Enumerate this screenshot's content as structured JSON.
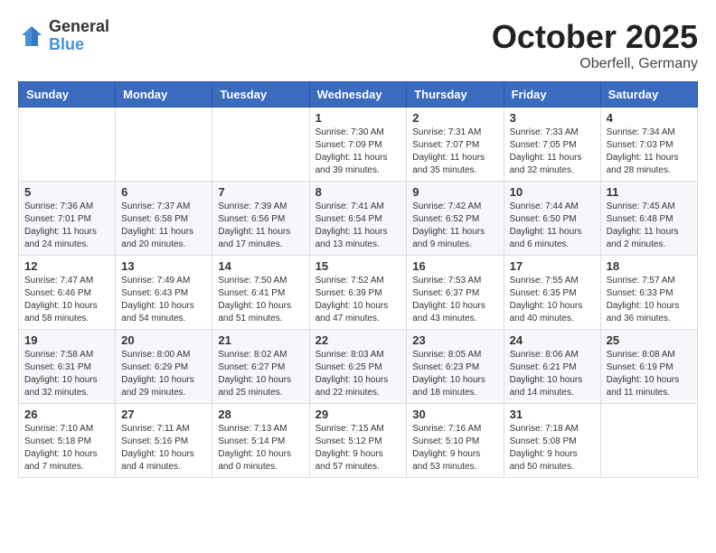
{
  "header": {
    "logo_general": "General",
    "logo_blue": "Blue",
    "month": "October 2025",
    "location": "Oberfell, Germany"
  },
  "weekdays": [
    "Sunday",
    "Monday",
    "Tuesday",
    "Wednesday",
    "Thursday",
    "Friday",
    "Saturday"
  ],
  "weeks": [
    [
      {
        "day": "",
        "info": ""
      },
      {
        "day": "",
        "info": ""
      },
      {
        "day": "",
        "info": ""
      },
      {
        "day": "1",
        "info": "Sunrise: 7:30 AM\nSunset: 7:09 PM\nDaylight: 11 hours\nand 39 minutes."
      },
      {
        "day": "2",
        "info": "Sunrise: 7:31 AM\nSunset: 7:07 PM\nDaylight: 11 hours\nand 35 minutes."
      },
      {
        "day": "3",
        "info": "Sunrise: 7:33 AM\nSunset: 7:05 PM\nDaylight: 11 hours\nand 32 minutes."
      },
      {
        "day": "4",
        "info": "Sunrise: 7:34 AM\nSunset: 7:03 PM\nDaylight: 11 hours\nand 28 minutes."
      }
    ],
    [
      {
        "day": "5",
        "info": "Sunrise: 7:36 AM\nSunset: 7:01 PM\nDaylight: 11 hours\nand 24 minutes."
      },
      {
        "day": "6",
        "info": "Sunrise: 7:37 AM\nSunset: 6:58 PM\nDaylight: 11 hours\nand 20 minutes."
      },
      {
        "day": "7",
        "info": "Sunrise: 7:39 AM\nSunset: 6:56 PM\nDaylight: 11 hours\nand 17 minutes."
      },
      {
        "day": "8",
        "info": "Sunrise: 7:41 AM\nSunset: 6:54 PM\nDaylight: 11 hours\nand 13 minutes."
      },
      {
        "day": "9",
        "info": "Sunrise: 7:42 AM\nSunset: 6:52 PM\nDaylight: 11 hours\nand 9 minutes."
      },
      {
        "day": "10",
        "info": "Sunrise: 7:44 AM\nSunset: 6:50 PM\nDaylight: 11 hours\nand 6 minutes."
      },
      {
        "day": "11",
        "info": "Sunrise: 7:45 AM\nSunset: 6:48 PM\nDaylight: 11 hours\nand 2 minutes."
      }
    ],
    [
      {
        "day": "12",
        "info": "Sunrise: 7:47 AM\nSunset: 6:46 PM\nDaylight: 10 hours\nand 58 minutes."
      },
      {
        "day": "13",
        "info": "Sunrise: 7:49 AM\nSunset: 6:43 PM\nDaylight: 10 hours\nand 54 minutes."
      },
      {
        "day": "14",
        "info": "Sunrise: 7:50 AM\nSunset: 6:41 PM\nDaylight: 10 hours\nand 51 minutes."
      },
      {
        "day": "15",
        "info": "Sunrise: 7:52 AM\nSunset: 6:39 PM\nDaylight: 10 hours\nand 47 minutes."
      },
      {
        "day": "16",
        "info": "Sunrise: 7:53 AM\nSunset: 6:37 PM\nDaylight: 10 hours\nand 43 minutes."
      },
      {
        "day": "17",
        "info": "Sunrise: 7:55 AM\nSunset: 6:35 PM\nDaylight: 10 hours\nand 40 minutes."
      },
      {
        "day": "18",
        "info": "Sunrise: 7:57 AM\nSunset: 6:33 PM\nDaylight: 10 hours\nand 36 minutes."
      }
    ],
    [
      {
        "day": "19",
        "info": "Sunrise: 7:58 AM\nSunset: 6:31 PM\nDaylight: 10 hours\nand 32 minutes."
      },
      {
        "day": "20",
        "info": "Sunrise: 8:00 AM\nSunset: 6:29 PM\nDaylight: 10 hours\nand 29 minutes."
      },
      {
        "day": "21",
        "info": "Sunrise: 8:02 AM\nSunset: 6:27 PM\nDaylight: 10 hours\nand 25 minutes."
      },
      {
        "day": "22",
        "info": "Sunrise: 8:03 AM\nSunset: 6:25 PM\nDaylight: 10 hours\nand 22 minutes."
      },
      {
        "day": "23",
        "info": "Sunrise: 8:05 AM\nSunset: 6:23 PM\nDaylight: 10 hours\nand 18 minutes."
      },
      {
        "day": "24",
        "info": "Sunrise: 8:06 AM\nSunset: 6:21 PM\nDaylight: 10 hours\nand 14 minutes."
      },
      {
        "day": "25",
        "info": "Sunrise: 8:08 AM\nSunset: 6:19 PM\nDaylight: 10 hours\nand 11 minutes."
      }
    ],
    [
      {
        "day": "26",
        "info": "Sunrise: 7:10 AM\nSunset: 5:18 PM\nDaylight: 10 hours\nand 7 minutes."
      },
      {
        "day": "27",
        "info": "Sunrise: 7:11 AM\nSunset: 5:16 PM\nDaylight: 10 hours\nand 4 minutes."
      },
      {
        "day": "28",
        "info": "Sunrise: 7:13 AM\nSunset: 5:14 PM\nDaylight: 10 hours\nand 0 minutes."
      },
      {
        "day": "29",
        "info": "Sunrise: 7:15 AM\nSunset: 5:12 PM\nDaylight: 9 hours\nand 57 minutes."
      },
      {
        "day": "30",
        "info": "Sunrise: 7:16 AM\nSunset: 5:10 PM\nDaylight: 9 hours\nand 53 minutes."
      },
      {
        "day": "31",
        "info": "Sunrise: 7:18 AM\nSunset: 5:08 PM\nDaylight: 9 hours\nand 50 minutes."
      },
      {
        "day": "",
        "info": ""
      }
    ]
  ]
}
